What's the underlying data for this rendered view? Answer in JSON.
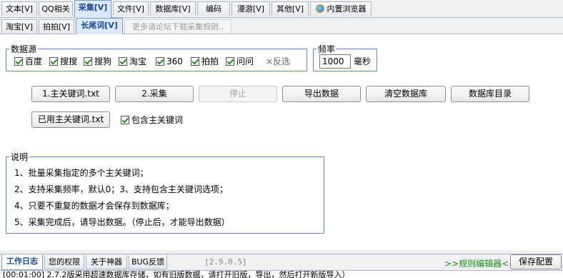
{
  "top_tabs": [
    "文本[V]",
    "QQ相关",
    "采集[V]",
    "文件[V]",
    "数据库[V]",
    "编码",
    "漫游[V]",
    "其他[V]",
    "内置浏览器"
  ],
  "sub_tabs": [
    "淘宝[V]",
    "拍拍[V]",
    "长尾词[V]",
    "更多请论坛下载采集规则.."
  ],
  "source_group": {
    "legend": "数据源",
    "sources": [
      "百度",
      "搜搜",
      "搜狗",
      "淘宝",
      "360",
      "拍拍",
      "问问"
    ],
    "invert_label": "×反选"
  },
  "frequency": {
    "legend": "频率",
    "value": "1000",
    "unit": "毫秒"
  },
  "buttons": {
    "main_keywords": "1.主关键词.txt",
    "collect": "2.采集",
    "stop": "停止",
    "export": "导出数据",
    "clear_db": "清空数据库",
    "db_dir": "数据库目录",
    "used_keywords": "已用主关键词.txt",
    "include_main": "包含主关键词"
  },
  "description": {
    "legend": "说明",
    "lines": [
      "1、批量采集指定的多个主关键词；",
      "2、支持采集频率，默认0；3、支持包含主关键词选项；",
      "4、只要不重复的数据才会保存到数据库；",
      "5、采集完成后，请导出数据。（停止后，才能导出数据）"
    ]
  },
  "bottom": {
    "tabs": [
      "工作日志",
      "您的权限",
      "关于神器",
      "BUG反馈"
    ],
    "version": "[2.9.0.5]",
    "rule_editor": ">>规则编辑器<<",
    "save_config": "保存配置",
    "log_line": "[00:01:00] 2.7.2版采用超速数据库存储，如有旧版数据，请打开旧版，导出，然后打开新版导入）"
  }
}
